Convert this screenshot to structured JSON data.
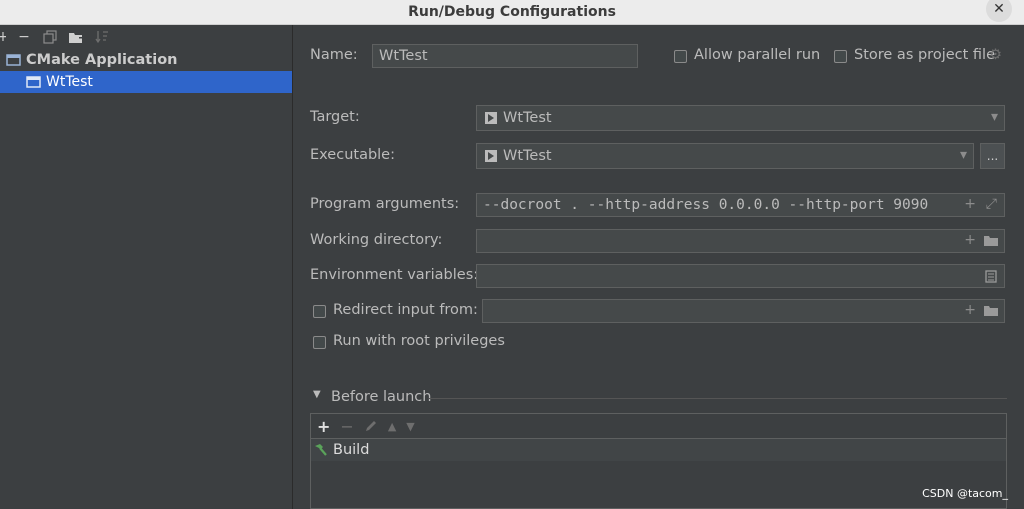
{
  "window": {
    "title": "Run/Debug Configurations",
    "close_glyph": "✕"
  },
  "sidebar": {
    "group_label": "CMake Application",
    "items": [
      {
        "label": "WtTest"
      }
    ]
  },
  "form": {
    "name_label": "Name:",
    "name_value": "WtTest",
    "allow_parallel_label": "Allow parallel run",
    "store_project_label": "Store as project file",
    "target_label": "Target:",
    "target_value": "WtTest",
    "executable_label": "Executable:",
    "executable_value": "WtTest",
    "browse_label": "...",
    "program_args_label": "Program arguments:",
    "program_args_value": "--docroot . --http-address 0.0.0.0 --http-port 9090",
    "working_dir_label": "Working directory:",
    "working_dir_value": "",
    "env_vars_label": "Environment variables:",
    "env_vars_value": "",
    "redirect_label": "Redirect input from:",
    "redirect_value": "",
    "root_priv_label": "Run with root privileges"
  },
  "before_launch": {
    "title": "Before launch",
    "tasks": [
      {
        "label": "Build"
      }
    ]
  },
  "watermark": "CSDN @tacom_",
  "colors": {
    "accent": "#2f65ca",
    "background": "#3c3f41",
    "field": "#45494a",
    "build_icon": "#5aa35a"
  }
}
